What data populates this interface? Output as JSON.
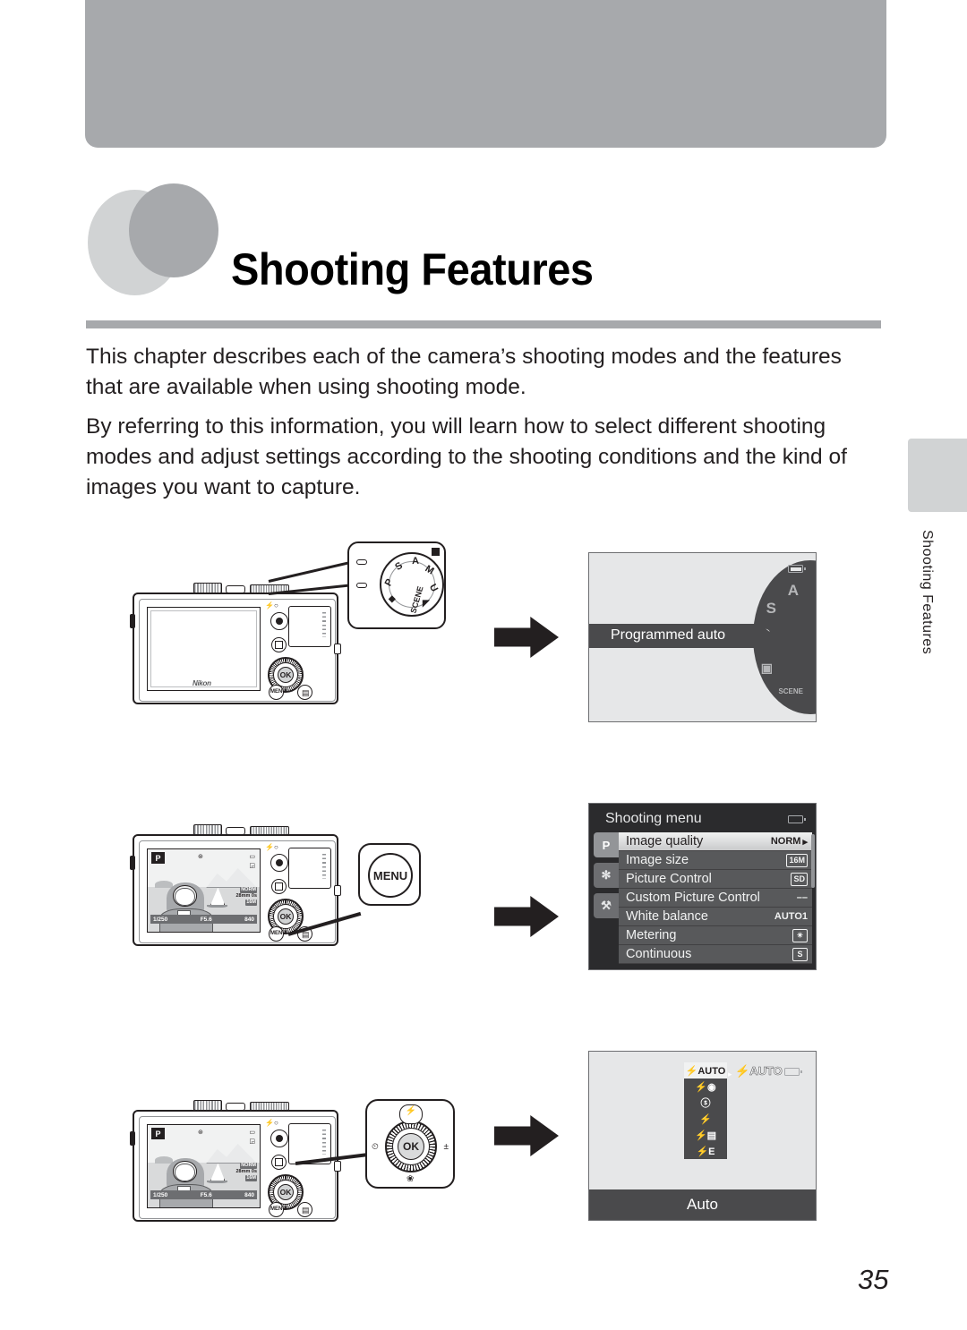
{
  "page": {
    "number": "35",
    "chapter_title": "Shooting Features",
    "edge_tab_label": "Shooting Features"
  },
  "intro": {
    "paragraph_1": "This chapter describes each of the camera’s shooting modes and the features that are available when using shooting mode.",
    "paragraph_2": "By referring to this information, you will learn how to select different shooting modes and adjust settings according to the shooting conditions and the kind of images you want to capture."
  },
  "mode_dial": {
    "labels": [
      "P",
      "S",
      "A",
      "M",
      "U",
      "SCENE"
    ],
    "effects_icon": "◆",
    "night_icon": "◤"
  },
  "mode_screen": {
    "banner_label": "Programmed auto",
    "dial_items": [
      {
        "label": "A",
        "selected": false
      },
      {
        "label": "S",
        "selected": false
      },
      {
        "label": "P",
        "selected": true
      },
      {
        "label": "▣",
        "selected": false
      },
      {
        "label": "SCENE",
        "selected": false
      }
    ],
    "battery_icon": "battery-icon"
  },
  "shooting_menu": {
    "title": "Shooting menu",
    "battery_icon": "battery-icon",
    "side_tabs": [
      {
        "name": "shooting-tab",
        "glyph": "P",
        "active": true
      },
      {
        "name": "movie-tab",
        "glyph": "✻",
        "active": false
      },
      {
        "name": "setup-tab",
        "glyph": "⚒",
        "active": false
      }
    ],
    "items": [
      {
        "label": "Image quality",
        "value": "NORM",
        "caret": "▸",
        "active": true
      },
      {
        "label": "Image size",
        "value": "16M",
        "caret": "",
        "active": false
      },
      {
        "label": "Picture Control",
        "value": "SD",
        "caret": "▸",
        "active": false
      },
      {
        "label": "Custom Picture Control",
        "value": "––",
        "caret": "",
        "active": false
      },
      {
        "label": "White balance",
        "value": "AUTO1",
        "caret": "",
        "active": false
      },
      {
        "label": "Metering",
        "value": "✴",
        "caret": "",
        "active": false
      },
      {
        "label": "Continuous",
        "value": "S",
        "caret": "",
        "active": false
      }
    ]
  },
  "flash_screen": {
    "current_label": "AUTO",
    "current_glyph": "⚡",
    "footer_label": "Auto",
    "battery_icon": "battery-icon",
    "options": [
      {
        "name": "flash-auto",
        "glyph": "⚡AUTO",
        "selected": true
      },
      {
        "name": "flash-red-eye",
        "glyph": "⚡◉",
        "selected": false
      },
      {
        "name": "flash-off",
        "glyph": "ⓢ",
        "selected": false
      },
      {
        "name": "flash-fill",
        "glyph": "⚡",
        "selected": false
      },
      {
        "name": "flash-slow-sync",
        "glyph": "⚡▤",
        "selected": false
      },
      {
        "name": "flash-rear-curtain",
        "glyph": "⚡E",
        "selected": false
      }
    ]
  },
  "callouts": {
    "menu_button_label": "MENU",
    "ok_button_label": "OK",
    "selector_top_icon": "⚡",
    "selector_left_icon": "⏲",
    "selector_right_icon": "±",
    "selector_bottom_icon": "❀"
  },
  "camera": {
    "brand": "Nikon",
    "ok_label": "OK",
    "menu_label": "MENU",
    "lcd": {
      "mode": "P",
      "shutter_speed": "1/250",
      "aperture": "F5.6",
      "frames": "840",
      "quality_chip": "NORM",
      "focal_info": "28mm  0s",
      "size_chip": "16M"
    }
  }
}
